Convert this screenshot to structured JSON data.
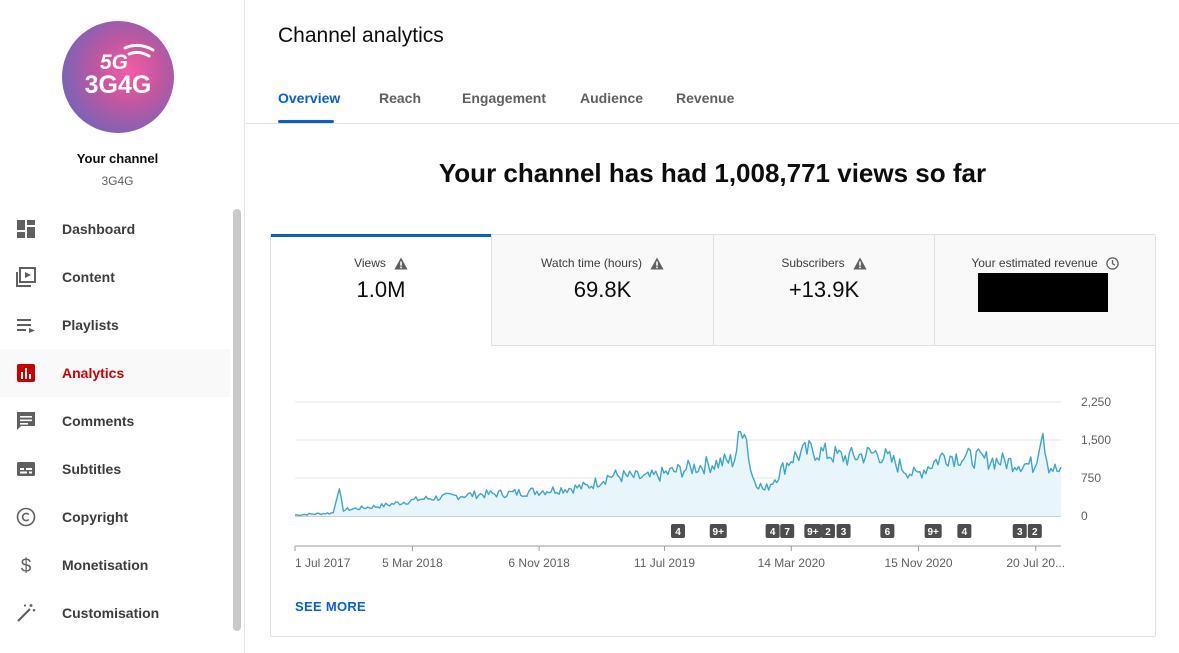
{
  "sidebar": {
    "avatar_text_top": "5G",
    "avatar_text_bottom": "3G4G",
    "your_channel": "Your channel",
    "channel_name": "3G4G",
    "items": [
      {
        "label": "Dashboard",
        "icon": "dashboard-icon"
      },
      {
        "label": "Content",
        "icon": "video-library-icon"
      },
      {
        "label": "Playlists",
        "icon": "playlist-icon"
      },
      {
        "label": "Analytics",
        "icon": "analytics-icon",
        "active": true
      },
      {
        "label": "Comments",
        "icon": "comment-icon"
      },
      {
        "label": "Subtitles",
        "icon": "subtitles-icon"
      },
      {
        "label": "Copyright",
        "icon": "copyright-icon"
      },
      {
        "label": "Monetisation",
        "icon": "dollar-icon"
      },
      {
        "label": "Customisation",
        "icon": "magic-wand-icon"
      }
    ]
  },
  "header": {
    "title": "Channel analytics",
    "tabs": [
      "Overview",
      "Reach",
      "Engagement",
      "Audience",
      "Revenue"
    ],
    "active_tab": "Overview"
  },
  "headline": "Your channel has had 1,008,771 views so far",
  "metrics": [
    {
      "label": "Views",
      "value": "1.0M",
      "icon": "warning-icon"
    },
    {
      "label": "Watch time (hours)",
      "value": "69.8K",
      "icon": "warning-icon"
    },
    {
      "label": "Subscribers",
      "value": "+13.9K",
      "icon": "warning-icon"
    },
    {
      "label": "Your estimated revenue",
      "value": "",
      "icon": "clock-icon"
    }
  ],
  "colors": {
    "accent": "#065fd4",
    "line": "#3ea6cc",
    "fill": "#e8f5fb",
    "active_nav": "#cc0000"
  },
  "chart_data": {
    "type": "area",
    "x_tick_labels": [
      "1 Jul 2017",
      "5 Mar 2018",
      "6 Nov 2018",
      "11 Jul 2019",
      "14 Mar 2020",
      "15 Nov 2020",
      "20 Jul 20..."
    ],
    "y_tick_labels": [
      "2,250",
      "1,500",
      "750",
      "0"
    ],
    "ylim": [
      0,
      2250
    ],
    "x_range": [
      "2017-07-01",
      "2021-08-31"
    ],
    "series": [
      {
        "anchors": [
          [
            "2017-07-01",
            20
          ],
          [
            "2017-09-15",
            60
          ],
          [
            "2017-09-25",
            550
          ],
          [
            "2017-10-05",
            120
          ],
          [
            "2017-12-20",
            200
          ],
          [
            "2018-03-05",
            330
          ],
          [
            "2018-06-15",
            420
          ],
          [
            "2018-09-01",
            450
          ],
          [
            "2018-11-06",
            500
          ],
          [
            "2019-02-01",
            580
          ],
          [
            "2019-03-20",
            800
          ],
          [
            "2019-06-01",
            750
          ],
          [
            "2019-07-11",
            850
          ],
          [
            "2019-09-20",
            1000
          ],
          [
            "2019-11-20",
            1100
          ],
          [
            "2019-12-10",
            1900
          ],
          [
            "2019-12-25",
            800
          ],
          [
            "2020-01-20",
            500
          ],
          [
            "2020-03-14",
            1150
          ],
          [
            "2020-04-20",
            1300
          ],
          [
            "2020-07-01",
            1150
          ],
          [
            "2020-09-01",
            1250
          ],
          [
            "2020-11-15",
            800
          ],
          [
            "2021-01-10",
            1200
          ],
          [
            "2021-03-01",
            1150
          ],
          [
            "2021-06-01",
            1050
          ],
          [
            "2021-07-10",
            1000
          ],
          [
            "2021-07-25",
            1800
          ],
          [
            "2021-08-05",
            1000
          ],
          [
            "2021-08-31",
            850
          ]
        ]
      }
    ],
    "markers": [
      {
        "label": "4",
        "date": "2019-08-01"
      },
      {
        "label": "9+",
        "date": "2019-10-20"
      },
      {
        "label": "4",
        "date": "2020-02-05"
      },
      {
        "label": "7",
        "date": "2020-03-05"
      },
      {
        "label": "9+",
        "date": "2020-04-25"
      },
      {
        "label": "2",
        "date": "2020-05-25"
      },
      {
        "label": "3",
        "date": "2020-06-25"
      },
      {
        "label": "6",
        "date": "2020-09-20"
      },
      {
        "label": "9+",
        "date": "2020-12-20"
      },
      {
        "label": "4",
        "date": "2021-02-20"
      },
      {
        "label": "3",
        "date": "2021-06-10"
      },
      {
        "label": "2",
        "date": "2021-07-10"
      }
    ],
    "grid": true
  },
  "see_more": "SEE MORE"
}
